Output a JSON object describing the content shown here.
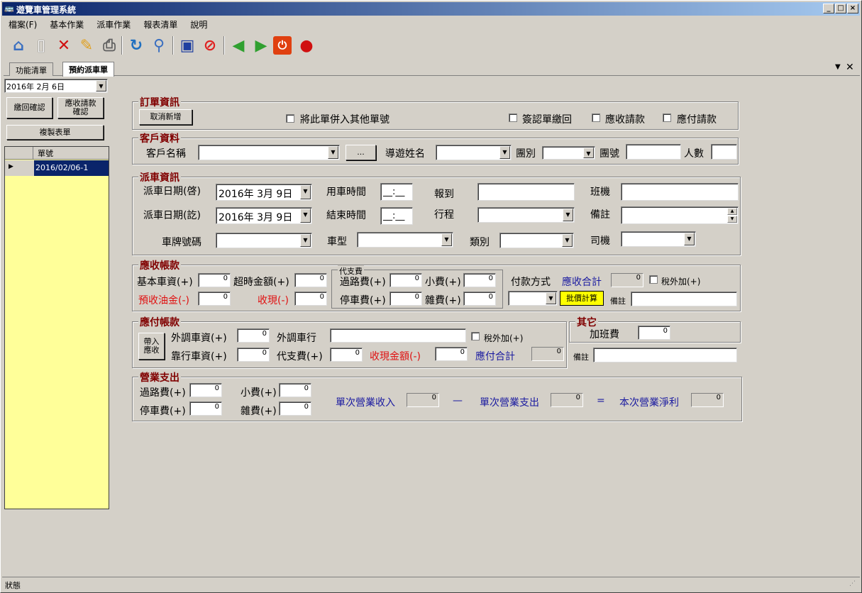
{
  "window": {
    "title": "遊覽車管理系統"
  },
  "menu": [
    "檔案(F)",
    "基本作業",
    "派車作業",
    "報表清單",
    "說明"
  ],
  "tabs": [
    "功能清單",
    "預約派車單"
  ],
  "sidebar": {
    "date": "2016年  2月  6日",
    "btn_return": "繳回確認",
    "btn_receivable": "應收請款確認",
    "btn_copy": "複製表單",
    "grid_header": "單號",
    "rows": [
      "2016/02/06-1"
    ]
  },
  "order": {
    "title": "訂單資訊",
    "btn_cancel": "取消新增",
    "merge_label": "將此單併入其他單號",
    "sign_label": "簽認單繳回",
    "recv_label": "應收請款",
    "pay_label": "應付請款"
  },
  "customer": {
    "title": "客戶資料",
    "name_label": "客戶名稱",
    "browse": "...",
    "guide_label": "導遊姓名",
    "group_label": "團別",
    "group_no_label": "團號",
    "count_label": "人數"
  },
  "dispatch": {
    "title": "派車資訊",
    "start_date_label": "派車日期(啓)",
    "start_date": "2016年  3月  9日",
    "use_time_label": "用車時間",
    "use_time": "__:__",
    "report_label": "報到",
    "flight_label": "班機",
    "end_date_label": "派車日期(訖)",
    "end_date": "2016年  3月  9日",
    "end_time_label": "結束時間",
    "end_time": "__:__",
    "route_label": "行程",
    "note_label": "備註",
    "plate_label": "車牌號碼",
    "car_type_label": "車型",
    "category_label": "類別",
    "driver_label": "司機"
  },
  "receivable": {
    "title": "應收帳款",
    "basic_label": "基本車資(+)",
    "basic": "0",
    "overtime_label": "超時金額(+)",
    "overtime": "0",
    "prepaid_label": "預收油金(-)",
    "prepaid": "0",
    "cash_label": "收現(-)",
    "cash": "0",
    "advance_title": "代支費",
    "toll_label": "過路費(+)",
    "toll": "0",
    "tip_label": "小費(+)",
    "tip": "0",
    "parking_label": "停車費(+)",
    "parking": "0",
    "misc_label": "雜費(+)",
    "misc": "0",
    "pay_method_label": "付款方式",
    "total_label": "應收合計",
    "total": "0",
    "tax_label": "稅外加(+)",
    "calc_btn": "批價計算",
    "note_label": "備註"
  },
  "payable": {
    "title": "應付帳款",
    "import_btn": "帶入應收",
    "ext_fee_label": "外調車資(+)",
    "ext_fee": "0",
    "ext_company_label": "外調車行",
    "tax_label": "稅外加(+)",
    "dep_fee_label": "靠行車資(+)",
    "dep_fee": "0",
    "advance_label": "代支費(+)",
    "advance": "0",
    "cash_label": "收現金額(-)",
    "cash": "0",
    "total_label": "應付合計",
    "total": "0"
  },
  "other": {
    "title": "其它",
    "overtime_label": "加班費",
    "overtime": "0",
    "note_label": "備註"
  },
  "expense": {
    "title": "營業支出",
    "toll_label": "過路費(+)",
    "toll": "0",
    "tip_label": "小費(+)",
    "tip": "0",
    "parking_label": "停車費(+)",
    "parking": "0",
    "misc_label": "雜費(+)",
    "misc": "0",
    "income_label": "單次營業收入",
    "income": "0",
    "minus": "—",
    "spend_label": "單次營業支出",
    "spend": "0",
    "equals": "=",
    "net_label": "本次營業淨利",
    "net": "0"
  },
  "status": {
    "text": "狀態"
  },
  "colors": {
    "title_start": "#0a246a",
    "title_end": "#a6caf0",
    "grid_bg": "#ffff99",
    "selected_row": "#0a246a",
    "calc_btn": "#ffff00"
  },
  "icons": [
    "home-icon",
    "new-document-icon",
    "delete-icon",
    "edit-icon",
    "print-icon",
    "refresh-icon",
    "search-icon",
    "save-icon",
    "cancel-icon",
    "back-icon",
    "forward-icon",
    "power-icon",
    "alarm-icon"
  ]
}
